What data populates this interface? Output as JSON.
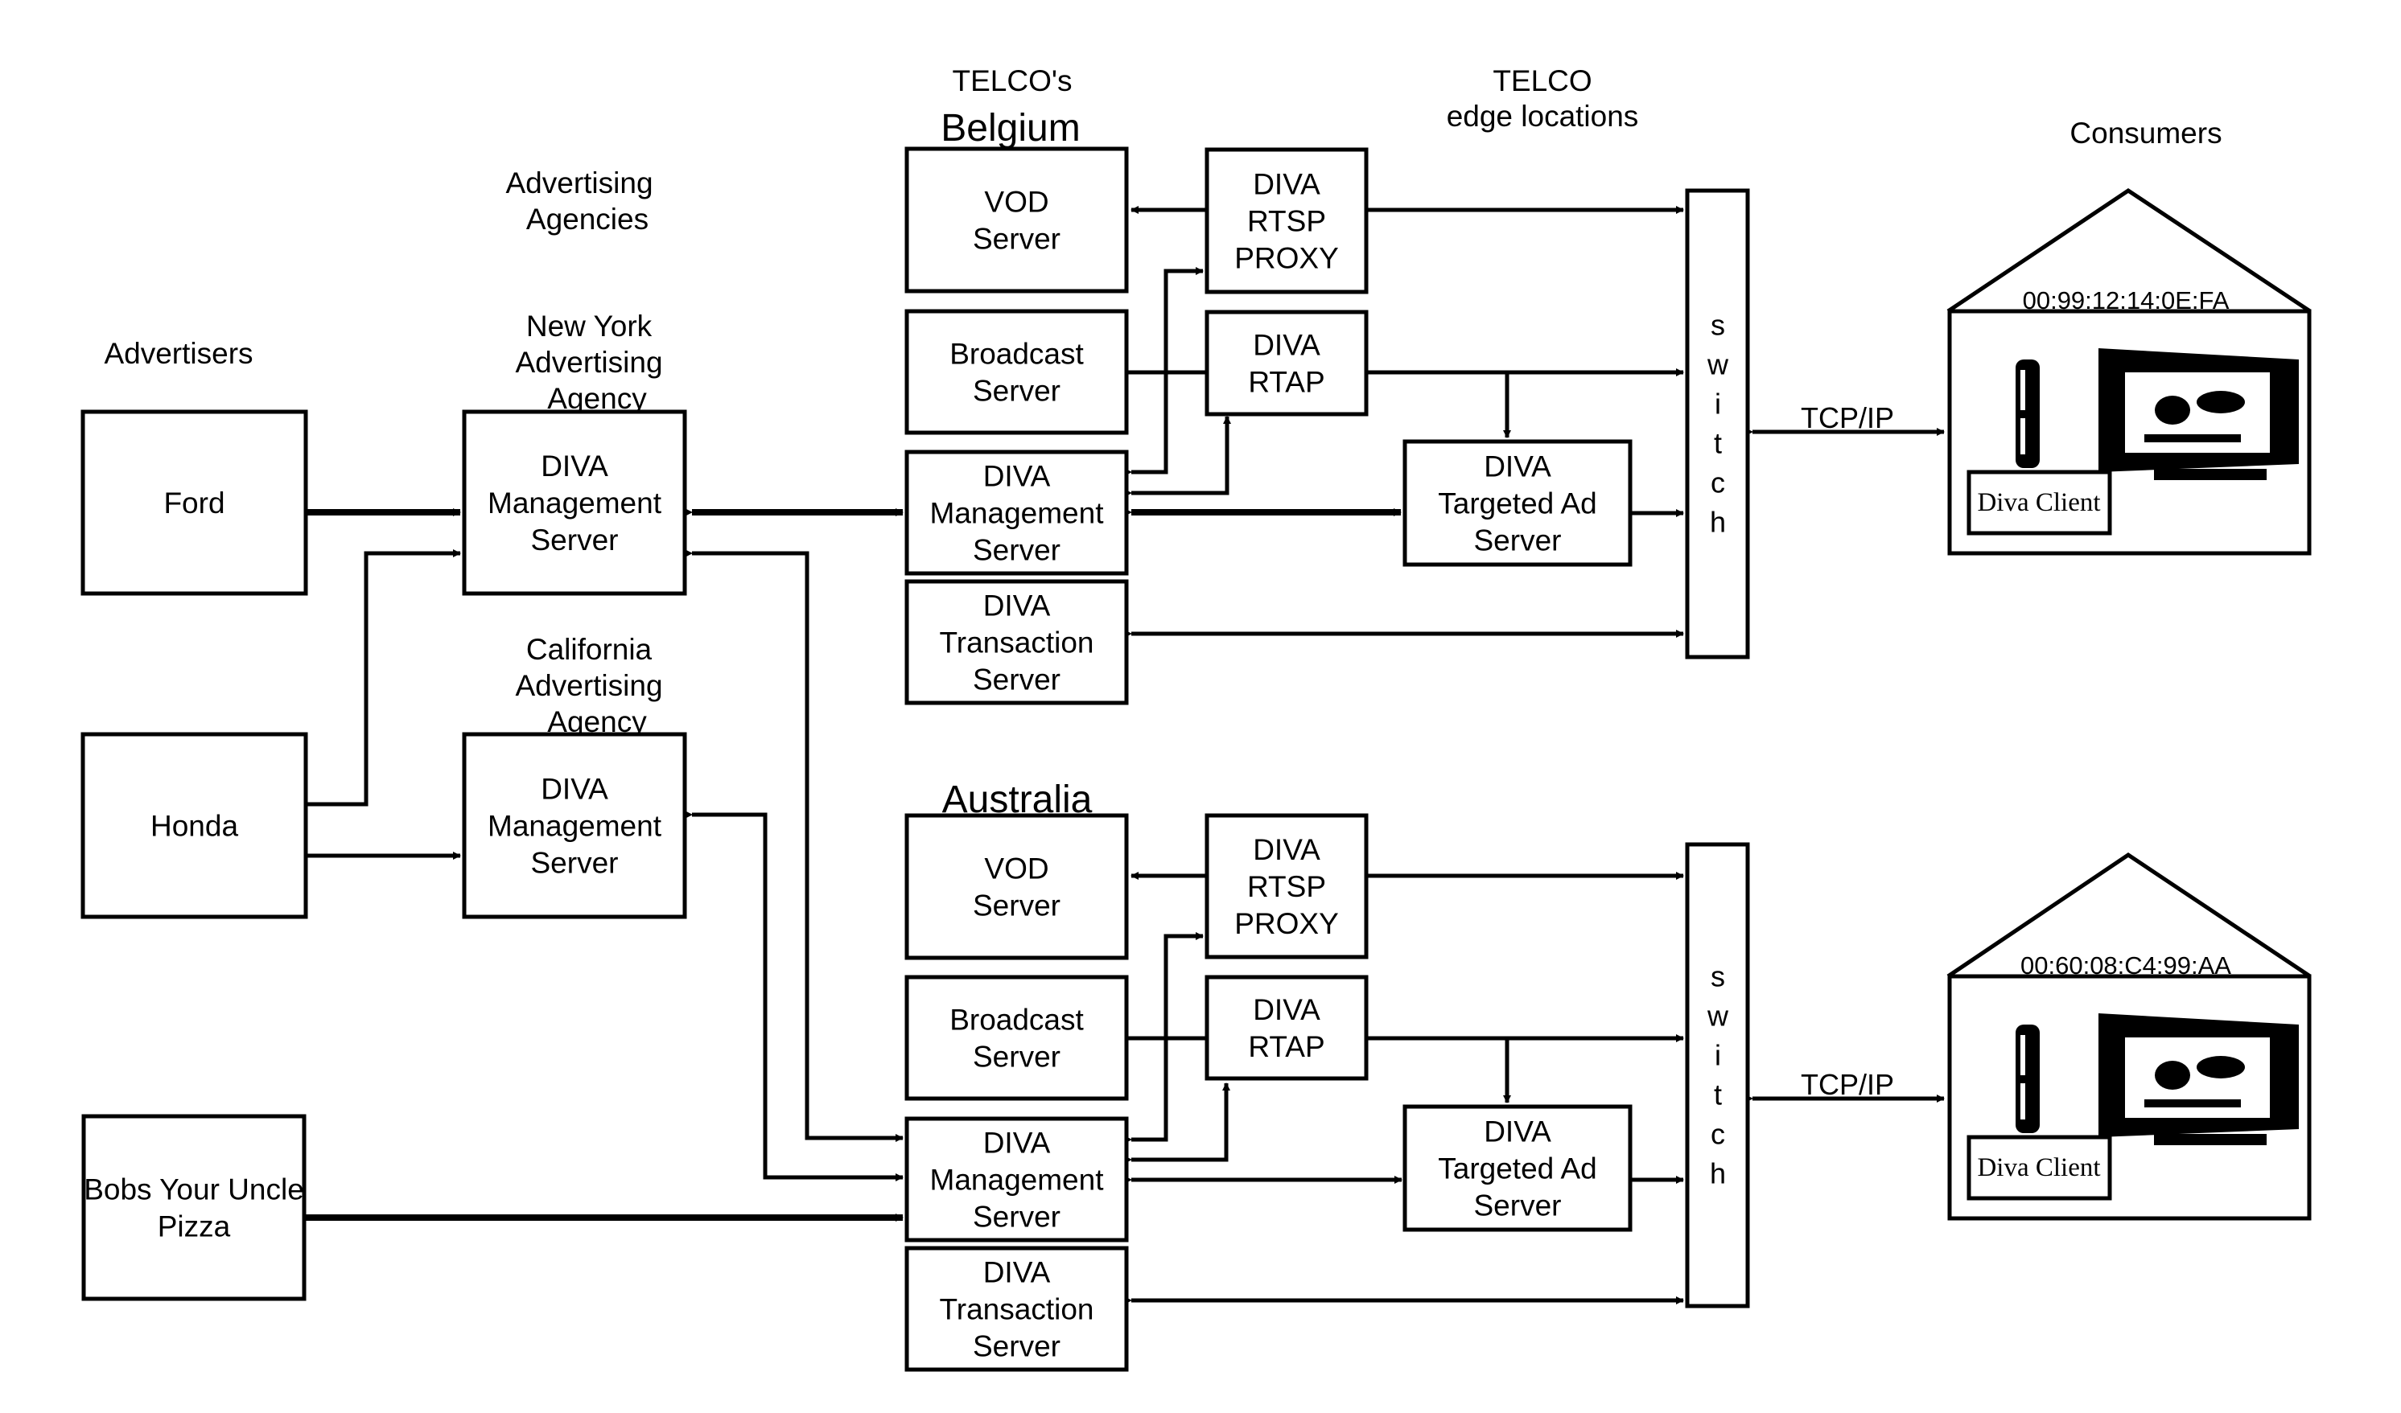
{
  "headers": {
    "advertisers": "Advertisers",
    "agencies": [
      "Advertising",
      "Agencies"
    ],
    "telcos": "TELCO's",
    "telco_edge": [
      "TELCO",
      "edge locations"
    ],
    "consumers": "Consumers"
  },
  "advertisers": [
    {
      "id": "ford",
      "label": [
        "Ford"
      ]
    },
    {
      "id": "honda",
      "label": [
        "Honda"
      ]
    },
    {
      "id": "bobs",
      "label": [
        "Bobs Your Uncle",
        "Pizza"
      ]
    }
  ],
  "agencies": [
    {
      "id": "ny",
      "title": [
        "New York",
        "Advertising",
        "Agency"
      ],
      "label": [
        "DIVA",
        "Management",
        "Server"
      ]
    },
    {
      "id": "ca",
      "title": [
        "California",
        "Advertising",
        "Agency"
      ],
      "label": [
        "DIVA",
        "Management",
        "Server"
      ]
    }
  ],
  "regions": [
    {
      "id": "belgium",
      "name": "Belgium",
      "vod": [
        "VOD",
        "Server"
      ],
      "broadcast": [
        "Broadcast",
        "Server"
      ],
      "mgmt": [
        "DIVA",
        "Management",
        "Server"
      ],
      "transaction": [
        "DIVA",
        "Transaction",
        "Server"
      ],
      "rtsp": [
        "DIVA",
        "RTSP",
        "PROXY"
      ],
      "rtap": [
        "DIVA",
        "RTAP"
      ],
      "targeted": [
        "DIVA",
        "Targeted Ad",
        "Server"
      ],
      "switch": [
        "s",
        "w",
        "i",
        "t",
        "c",
        "h"
      ],
      "link": "TCP/IP",
      "consumer": {
        "mac": "00:99:12:14:0E:FA",
        "client": "Diva Client"
      }
    },
    {
      "id": "australia",
      "name": "Australia",
      "vod": [
        "VOD",
        "Server"
      ],
      "broadcast": [
        "Broadcast",
        "Server"
      ],
      "mgmt": [
        "DIVA",
        "Management",
        "Server"
      ],
      "transaction": [
        "DIVA",
        "Transaction",
        "Server"
      ],
      "rtsp": [
        "DIVA",
        "RTSP",
        "PROXY"
      ],
      "rtap": [
        "DIVA",
        "RTAP"
      ],
      "targeted": [
        "DIVA",
        "Targeted Ad",
        "Server"
      ],
      "switch": [
        "s",
        "w",
        "i",
        "t",
        "c",
        "h"
      ],
      "link": "TCP/IP",
      "consumer": {
        "mac": "00:60:08:C4:99:AA",
        "client": "Diva Client"
      }
    }
  ],
  "icons": {
    "set_top_box": "set-top-box-icon",
    "television": "television-icon",
    "house": "house-icon"
  }
}
